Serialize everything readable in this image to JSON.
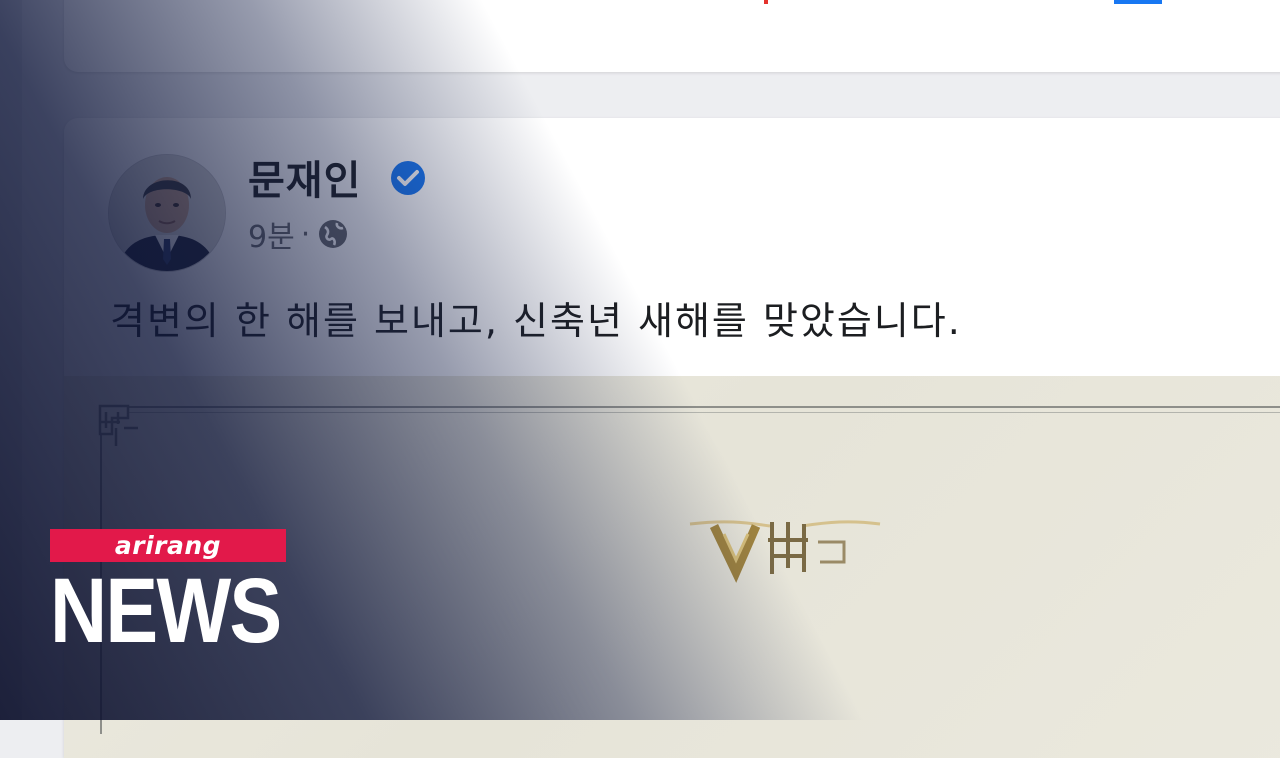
{
  "post": {
    "author_name": "문재인",
    "time": "9분",
    "separator": "·",
    "audience_icon": "globe-icon",
    "verified_icon": "verified-badge-icon",
    "text": "격변의 한 해를 보내고, 신축년 새해를 맞았습니다."
  },
  "overlay": {
    "brand_name": "arirang",
    "brand_label": "NEWS"
  },
  "colors": {
    "verified_blue": "#1877f2",
    "brand_pink": "#e2194a",
    "text_primary": "#1c1e21",
    "text_secondary": "#65676b"
  }
}
